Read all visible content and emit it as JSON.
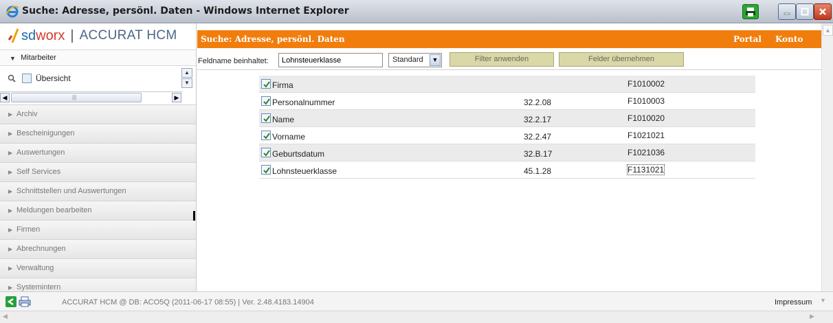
{
  "window": {
    "title": "Suche: Adresse, persönl. Daten - Windows Internet Explorer"
  },
  "brand": {
    "logo_sd": "sd",
    "logo_worx": "worx",
    "separator": "|",
    "product": "ACCURAT HCM"
  },
  "sidebar": {
    "section": "Mitarbeiter",
    "tree_item": "Übersicht",
    "items": [
      {
        "label": "Archiv"
      },
      {
        "label": "Bescheinigungen"
      },
      {
        "label": "Auswertungen"
      },
      {
        "label": "Self Services"
      },
      {
        "label": "Schnittstellen und Auswertungen"
      },
      {
        "label": "Meldungen bearbeiten"
      },
      {
        "label": "Firmen"
      },
      {
        "label": "Abrechnungen"
      },
      {
        "label": "Verwaltung"
      },
      {
        "label": "Systemintern"
      }
    ]
  },
  "header": {
    "title": "Suche: Adresse, persönl. Daten",
    "portal": "Portal",
    "konto": "Konto"
  },
  "filter": {
    "label": "Feldname beinhaltet:",
    "value": "Lohnsteuerklasse",
    "select_value": "Standard",
    "apply_button": "Filter anwenden",
    "take_button": "Felder übernehmen"
  },
  "fields": [
    {
      "name": "Firma",
      "code": "",
      "id": "F1010002",
      "checked": true
    },
    {
      "name": "Personalnummer",
      "code": "32.2.08",
      "id": "F1010003",
      "checked": true
    },
    {
      "name": "Name",
      "code": "32.2.17",
      "id": "F1010020",
      "checked": true
    },
    {
      "name": "Vorname",
      "code": "32.2.47",
      "id": "F1021021",
      "checked": true
    },
    {
      "name": "Geburtsdatum",
      "code": "32.B.17",
      "id": "F1021036",
      "checked": true
    },
    {
      "name": "Lohnsteuerklasse",
      "code": "45.1.28",
      "id": "F1131021",
      "checked": true
    }
  ],
  "status": {
    "text": "ACCURAT HCM @ DB: ACO5Q (2011-06-17 08:55) | Ver. 2.48.4183.14904",
    "impressum": "Impressum"
  },
  "colors": {
    "accent": "#f07d0c",
    "button_bg": "#d9d8a6",
    "row_alt": "#ebebeb"
  }
}
